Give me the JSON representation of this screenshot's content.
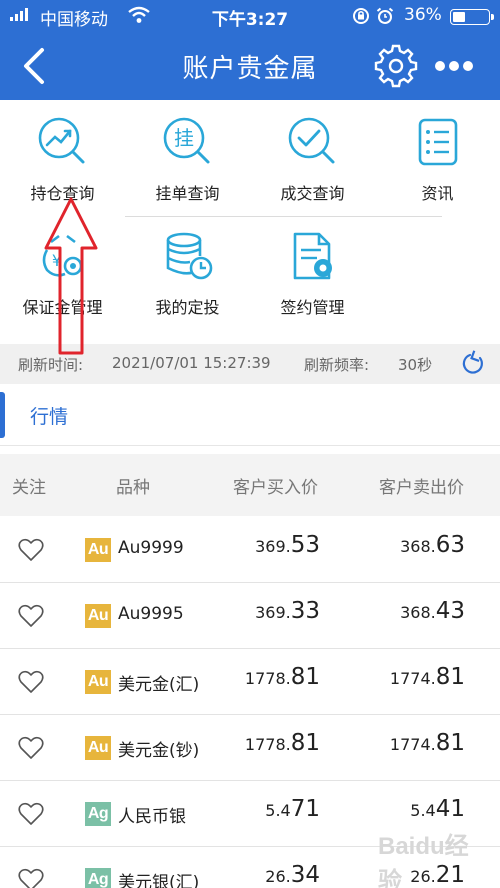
{
  "status_bar": {
    "carrier": "中国移动",
    "time": "下午3:27",
    "battery": "36%",
    "battery_level": 0.36
  },
  "nav": {
    "title": "账户贵金属"
  },
  "menu": [
    {
      "label": "持仓查询",
      "icon": "chart-magnifier-icon"
    },
    {
      "label": "挂单查询",
      "icon": "pending-order-magnifier-icon"
    },
    {
      "label": "成交查询",
      "icon": "check-magnifier-icon"
    },
    {
      "label": "资讯",
      "icon": "news-list-icon"
    },
    {
      "label": "保证金管理",
      "icon": "margin-gear-icon"
    },
    {
      "label": "我的定投",
      "icon": "database-clock-icon"
    },
    {
      "label": "签约管理",
      "icon": "contract-document-icon"
    }
  ],
  "refresh": {
    "time_label": "刷新时间:",
    "time_value": "2021/07/01 15:27:39",
    "freq_label": "刷新频率:",
    "freq_value": "30秒"
  },
  "tab": {
    "label": "行情"
  },
  "table": {
    "headers": {
      "follow": "关注",
      "variety": "品种",
      "buy": "客户买入价",
      "sell": "客户卖出价"
    },
    "rows": [
      {
        "badge": "Au",
        "name": "Au9999",
        "buy_small": "369.",
        "buy_big": "53",
        "sell_small": "368.",
        "sell_big": "63"
      },
      {
        "badge": "Au",
        "name": "Au9995",
        "buy_small": "369.",
        "buy_big": "33",
        "sell_small": "368.",
        "sell_big": "43"
      },
      {
        "badge": "Au",
        "name": "美元金(汇)",
        "buy_small": "1778.",
        "buy_big": "81",
        "sell_small": "1774.",
        "sell_big": "81"
      },
      {
        "badge": "Au",
        "name": "美元金(钞)",
        "buy_small": "1778.",
        "buy_big": "81",
        "sell_small": "1774.",
        "sell_big": "81"
      },
      {
        "badge": "Ag",
        "name": "人民币银",
        "buy_small": "5.4",
        "buy_big": "71",
        "sell_small": "5.4",
        "sell_big": "41"
      },
      {
        "badge": "Ag",
        "name": "美元银(汇)",
        "buy_small": "26.",
        "buy_big": "34",
        "sell_small": "26.",
        "sell_big": "21"
      }
    ]
  },
  "watermark": "Baidu经验",
  "colors": {
    "primary": "#2d6fd3",
    "icon": "#2aa7d8",
    "gold": "#e7b53c",
    "silver": "#7bc0a6",
    "arrow": "#e0242c"
  }
}
